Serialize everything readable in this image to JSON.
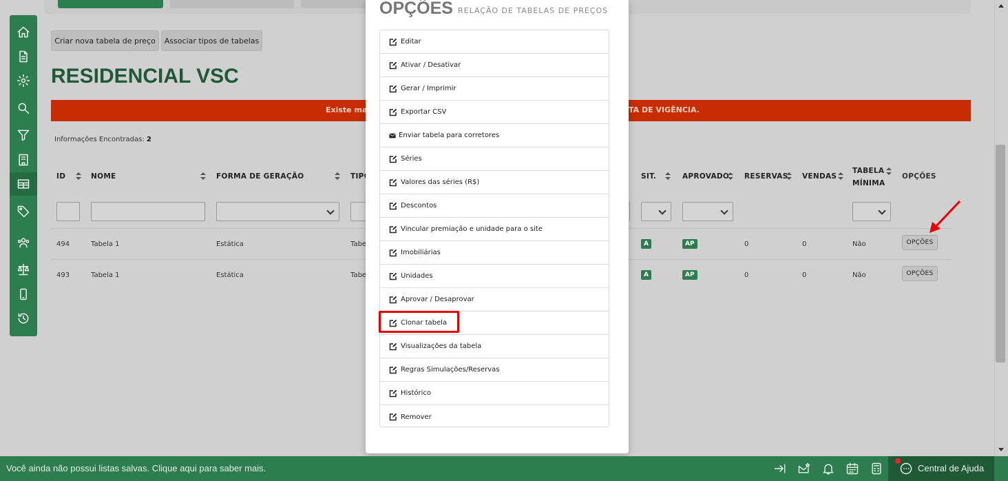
{
  "toolbar": {
    "create_table": "Criar nova tabela de preço",
    "associate_types": "Associar tipos de tabelas"
  },
  "page": {
    "title": "RESIDENCIAL VSC",
    "alert_left": "Existe mai",
    "alert_right": "TA DE VIGÊNCIA.",
    "info_label": "Informações Encontradas:",
    "info_count": "2"
  },
  "table": {
    "headers": {
      "id": "ID",
      "nome": "NOME",
      "forma": "FORMA DE GERAÇÃO",
      "tipo": "TIPO",
      "sit": "SIT.",
      "aprovado": "APROVADO",
      "reservas": "RESERVAS",
      "vendas": "VENDAS",
      "tabela_minima_1": "TABELA",
      "tabela_minima_2": "MÍNIMA",
      "opcoes": "OPÇÕES"
    },
    "rows": [
      {
        "id": "494",
        "nome": "Tabela 1",
        "forma": "Estática",
        "tipo": "Tabe",
        "sit": "A",
        "aprovado": "AP",
        "reservas": "0",
        "vendas": "0",
        "minima": "Não",
        "opcoes": "OPÇÕES"
      },
      {
        "id": "493",
        "nome": "Tabela 1",
        "forma": "Estática",
        "tipo": "Tabe",
        "sit": "A",
        "aprovado": "AP",
        "reservas": "0",
        "vendas": "0",
        "minima": "Não",
        "opcoes": "OPÇÕES"
      }
    ]
  },
  "modal": {
    "title": "OPÇÕES",
    "subtitle": "RELAÇÃO DE TABELAS DE PREÇOS",
    "options": [
      {
        "label": "Editar",
        "icon": "edit-icon"
      },
      {
        "label": "Ativar / Desativar",
        "icon": "edit-icon"
      },
      {
        "label": "Gerar / Imprimir",
        "icon": "edit-icon"
      },
      {
        "label": "Exportar CSV",
        "icon": "edit-icon"
      },
      {
        "label": "Enviar tabela para corretores",
        "icon": "envelope-icon"
      },
      {
        "label": "Séries",
        "icon": "edit-icon"
      },
      {
        "label": "Valores das séries (R$)",
        "icon": "edit-icon"
      },
      {
        "label": "Descontos",
        "icon": "edit-icon"
      },
      {
        "label": "Vincular premiação e unidade para o site",
        "icon": "edit-icon"
      },
      {
        "label": "Imobiliárias",
        "icon": "edit-icon"
      },
      {
        "label": "Unidades",
        "icon": "edit-icon"
      },
      {
        "label": "Aprovar / Desaprovar",
        "icon": "edit-icon"
      },
      {
        "label": "Clonar tabela",
        "icon": "edit-icon"
      },
      {
        "label": "Visualizações da tabela",
        "icon": "edit-icon"
      },
      {
        "label": "Regras Simulações/Reservas",
        "icon": "edit-icon"
      },
      {
        "label": "Histórico",
        "icon": "edit-icon"
      },
      {
        "label": "Remover",
        "icon": "edit-icon"
      }
    ]
  },
  "bottom_bar": {
    "message": "Você ainda não possui listas salvas. Clique aqui para saber mais.",
    "help": "Central de Ajuda"
  },
  "colors": {
    "brand_green": "#2e7d4f",
    "title_green": "#1f5a37",
    "alert_red": "#c72c02",
    "highlight_red": "#e60000"
  }
}
